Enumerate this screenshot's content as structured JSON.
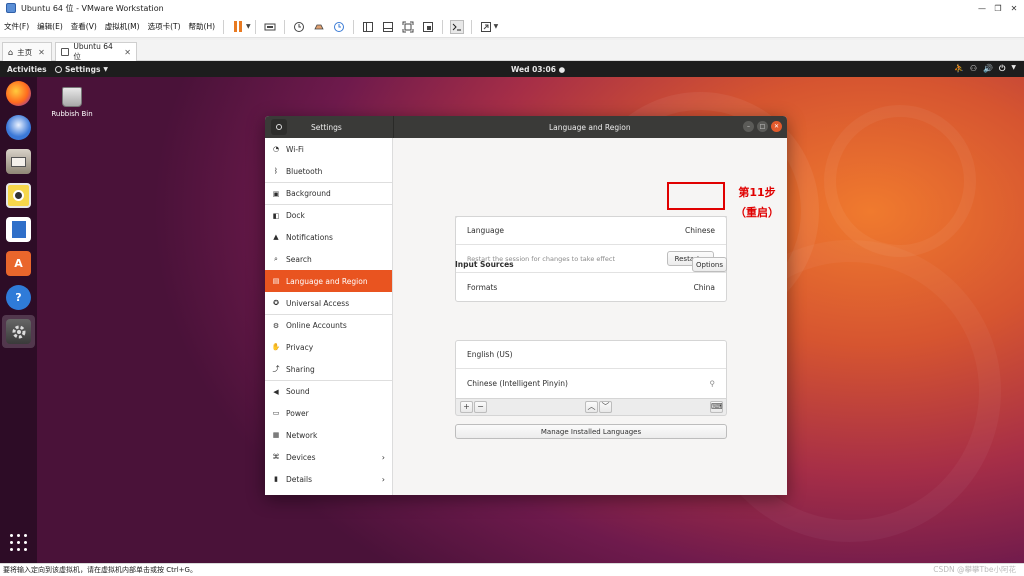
{
  "vmware": {
    "title": "Ubuntu 64 位 - VMware Workstation",
    "menu": [
      "文件(F)",
      "编辑(E)",
      "查看(V)",
      "虚拟机(M)",
      "选项卡(T)",
      "帮助(H)"
    ],
    "tabs": [
      {
        "label": "主页",
        "icon": "home-icon"
      },
      {
        "label": "Ubuntu 64 位",
        "icon": "vm-tab-icon"
      }
    ],
    "status_text": "要将输入定向到该虚拟机，请在虚拟机内部单击或按 Ctrl+G。",
    "watermark": "CSDN @攀攀Tbe小阿花",
    "accent": "#e87a22"
  },
  "ubuntu": {
    "activities": "Activities",
    "app_menu": "Settings",
    "clock": "Wed 03:06",
    "desktop_icon_label": "Rubbish Bin"
  },
  "settings": {
    "left_title": "Settings",
    "main_title": "Language and Region",
    "sidebar": [
      {
        "label": "Wi-Fi",
        "icon": "wifi-icon"
      },
      {
        "label": "Bluetooth",
        "icon": "bluetooth-icon"
      },
      {
        "label": "Background",
        "icon": "background-icon"
      },
      {
        "label": "Dock",
        "icon": "dock-icon"
      },
      {
        "label": "Notifications",
        "icon": "bell-icon"
      },
      {
        "label": "Search",
        "icon": "search-icon"
      },
      {
        "label": "Language and Region",
        "icon": "language-icon"
      },
      {
        "label": "Universal Access",
        "icon": "accessibility-icon"
      },
      {
        "label": "Online Accounts",
        "icon": "online-accounts-icon"
      },
      {
        "label": "Privacy",
        "icon": "hand-icon"
      },
      {
        "label": "Sharing",
        "icon": "share-icon"
      },
      {
        "label": "Sound",
        "icon": "speaker-icon"
      },
      {
        "label": "Power",
        "icon": "power-icon"
      },
      {
        "label": "Network",
        "icon": "network-icon"
      },
      {
        "label": "Devices",
        "icon": "devices-icon"
      },
      {
        "label": "Details",
        "icon": "details-icon"
      }
    ],
    "language_label": "Language",
    "language_value": "Chinese",
    "restart_hint": "Restart the session for changes to take effect",
    "restart_button": "Restart...",
    "formats_label": "Formats",
    "formats_value": "China",
    "input_sources_title": "Input Sources",
    "options_button": "Options",
    "input_sources": [
      "English (US)",
      "Chinese (Intelligent Pinyin)"
    ],
    "add_symbol": "+",
    "remove_symbol": "−",
    "manage_button": "Manage Installed Languages",
    "accent": "#e95420"
  },
  "annotation": {
    "line1": "第11步",
    "line2": "（重启）",
    "color": "#e00000"
  }
}
